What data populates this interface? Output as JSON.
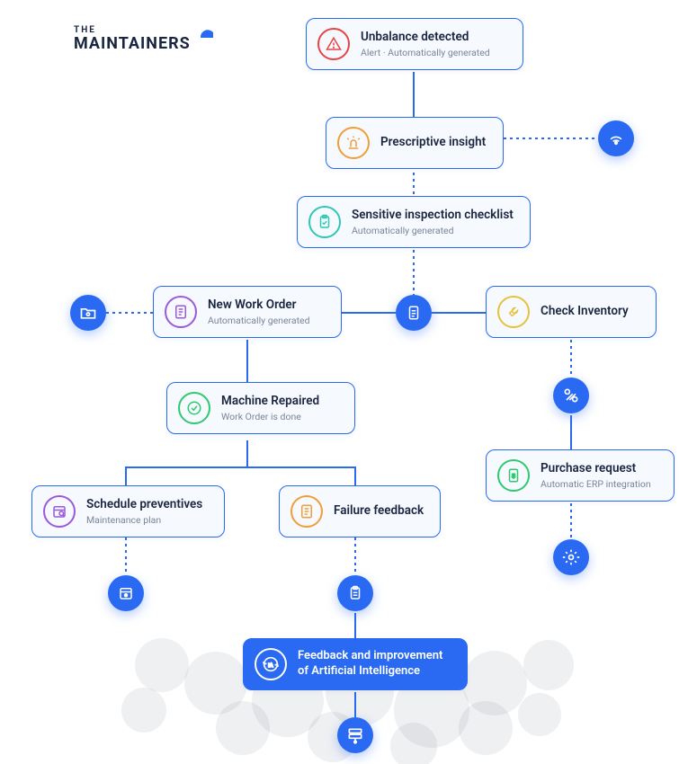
{
  "brand": {
    "line1": "THE",
    "line2": "MAINTAINERS"
  },
  "nodes": {
    "unbalance": {
      "title": "Unbalance detected",
      "subtitle": "Alert · Automatically generated"
    },
    "prescriptive": {
      "title": "Prescriptive insight"
    },
    "checklist": {
      "title": "Sensitive inspection checklist",
      "subtitle": "Automatically generated"
    },
    "workorder": {
      "title": "New Work Order",
      "subtitle": "Automatically generated"
    },
    "checkinv": {
      "title": "Check Inventory"
    },
    "repaired": {
      "title": "Machine Repaired",
      "subtitle": "Work Order is done"
    },
    "purchase": {
      "title": "Purchase request",
      "subtitle": "Automatic ERP integration"
    },
    "schedule": {
      "title": "Schedule preventives",
      "subtitle": "Maintenance plan"
    },
    "failure": {
      "title": "Failure feedback"
    },
    "ai": {
      "title": "Feedback and improvement of Artificial Intelligence"
    }
  },
  "colors": {
    "blue": "#2a6af3",
    "red": "#e64545",
    "orange": "#f29e38",
    "green": "#2ec971",
    "purple": "#9b59e0",
    "yellow": "#e6c23c",
    "teal": "#2ec9b5"
  }
}
